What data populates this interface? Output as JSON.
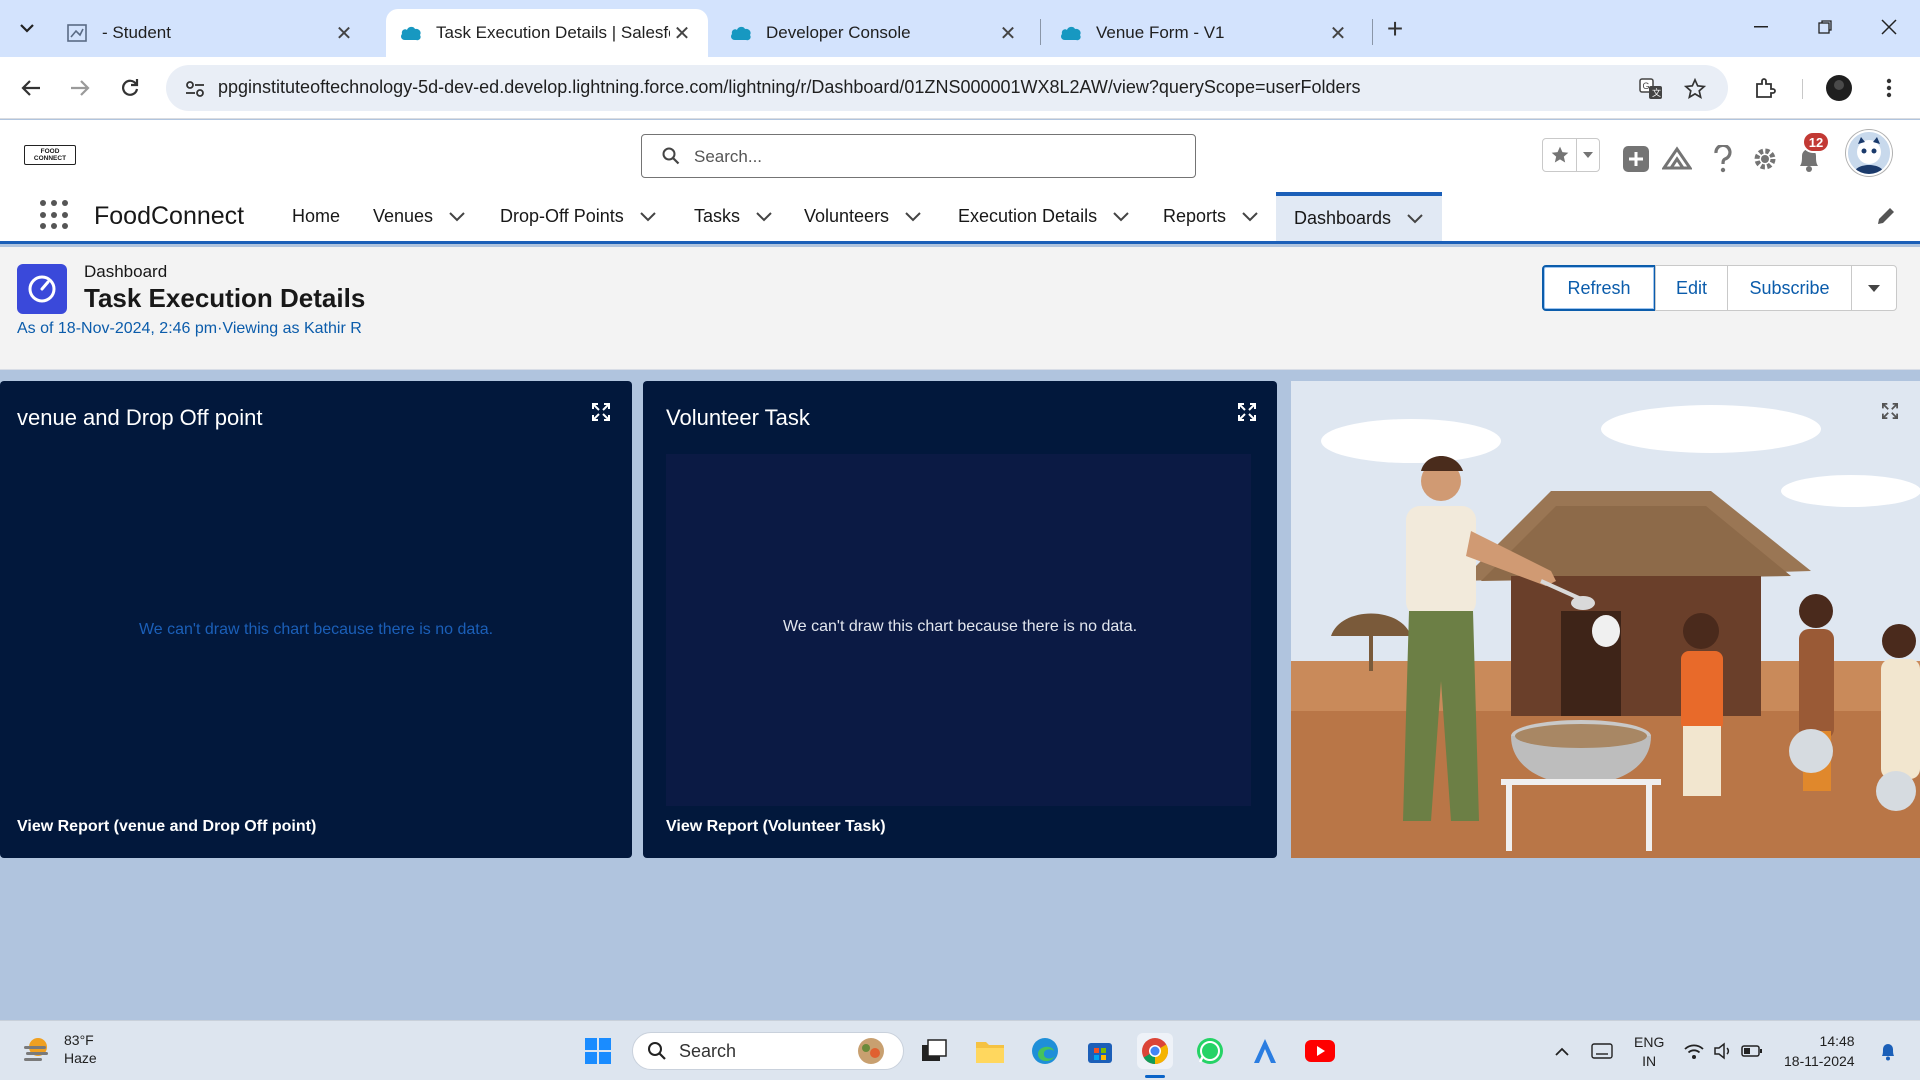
{
  "browser": {
    "tabs": [
      {
        "title": "- Student",
        "active": false
      },
      {
        "title": "Task Execution Details | Salesfor",
        "active": true
      },
      {
        "title": "Developer Console",
        "active": false
      },
      {
        "title": "Venue Form - V1",
        "active": false
      }
    ],
    "url": "ppginstituteoftechnology-5d-dev-ed.develop.lightning.force.com/lightning/r/Dashboard/01ZNS000001WX8L2AW/view?queryScope=userFolders"
  },
  "sf": {
    "logo_text": "FOOD CONNECT",
    "search_placeholder": "Search...",
    "notification_count": "12",
    "app_name": "FoodConnect",
    "nav": [
      "Home",
      "Venues",
      "Drop-Off Points",
      "Tasks",
      "Volunteers",
      "Execution Details",
      "Reports",
      "Dashboards"
    ],
    "active_nav": "Dashboards"
  },
  "dashboard": {
    "type_label": "Dashboard",
    "title": "Task Execution Details",
    "meta": "As of 18-Nov-2024, 2:46 pm·Viewing as Kathir R",
    "buttons": {
      "refresh": "Refresh",
      "edit": "Edit",
      "subscribe": "Subscribe"
    },
    "components": [
      {
        "title": "venue and Drop Off point",
        "message": "We can't draw this chart because there is no data.",
        "link": "View Report (venue and Drop Off point)"
      },
      {
        "title": "Volunteer Task",
        "message": "We can't draw this chart because there is no data.",
        "link": "View Report (Volunteer Task)"
      }
    ]
  },
  "taskbar": {
    "weather_temp": "83°F",
    "weather_desc": "Haze",
    "search_label": "Search",
    "lang_1": "ENG",
    "lang_2": "IN",
    "time": "14:48",
    "date": "18-11-2024"
  },
  "colors": {
    "brand": "#0b5cab",
    "card_bg": "#02183c",
    "canvas_bg": "#b0c4de",
    "notif": "#c23934"
  }
}
